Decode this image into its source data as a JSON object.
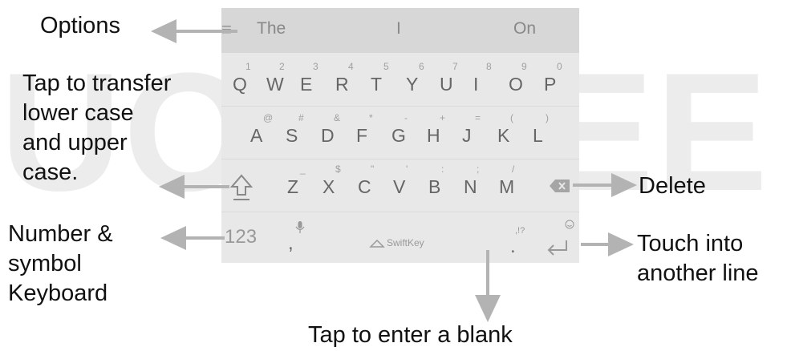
{
  "suggestions": [
    "The",
    "I",
    "On"
  ],
  "rows": [
    [
      {
        "main": "Q",
        "hint": "1"
      },
      {
        "main": "W",
        "hint": "2"
      },
      {
        "main": "E",
        "hint": "3"
      },
      {
        "main": "R",
        "hint": "4"
      },
      {
        "main": "T",
        "hint": "5"
      },
      {
        "main": "Y",
        "hint": "6"
      },
      {
        "main": "U",
        "hint": "7"
      },
      {
        "main": "I",
        "hint": "8"
      },
      {
        "main": "O",
        "hint": "9"
      },
      {
        "main": "P",
        "hint": "0"
      }
    ],
    [
      {
        "main": "A",
        "hint": "@"
      },
      {
        "main": "S",
        "hint": "#"
      },
      {
        "main": "D",
        "hint": "&"
      },
      {
        "main": "F",
        "hint": "*"
      },
      {
        "main": "G",
        "hint": "-"
      },
      {
        "main": "H",
        "hint": "+"
      },
      {
        "main": "J",
        "hint": "="
      },
      {
        "main": "K",
        "hint": "("
      },
      {
        "main": "L",
        "hint": ")"
      }
    ],
    [
      {
        "main": "Z",
        "hint": "_"
      },
      {
        "main": "X",
        "hint": "$"
      },
      {
        "main": "C",
        "hint": "\""
      },
      {
        "main": "V",
        "hint": "'"
      },
      {
        "main": "B",
        "hint": ":"
      },
      {
        "main": "N",
        "hint": ";"
      },
      {
        "main": "M",
        "hint": "/"
      }
    ]
  ],
  "bottom": {
    "number_key": "123",
    "comma_key": ",",
    "space_brand": "SwiftKey",
    "period_key": ".",
    "punct_hint": ",!?"
  },
  "labels": {
    "options": "Options",
    "shift": [
      "Tap to transfer",
      "lower case",
      "and upper",
      "case."
    ],
    "number": [
      "Number &",
      "symbol",
      "Keyboard"
    ],
    "delete": "Delete",
    "enter": [
      "Touch into",
      "another line"
    ],
    "space": "Tap to enter a blank"
  },
  "watermark": "UOGIFEE",
  "icons": {
    "menu": "menu-icon",
    "shift": "shift-icon",
    "delete": "backspace-icon",
    "mic": "microphone-icon",
    "emoji": "emoji-icon",
    "enter": "enter-icon",
    "logo": "swiftkey-logo-icon"
  },
  "colors": {
    "keyboard_bg": "#e8e8e8",
    "suggestion_bg": "#d7d7d7",
    "arrow": "#b3b3b3"
  }
}
